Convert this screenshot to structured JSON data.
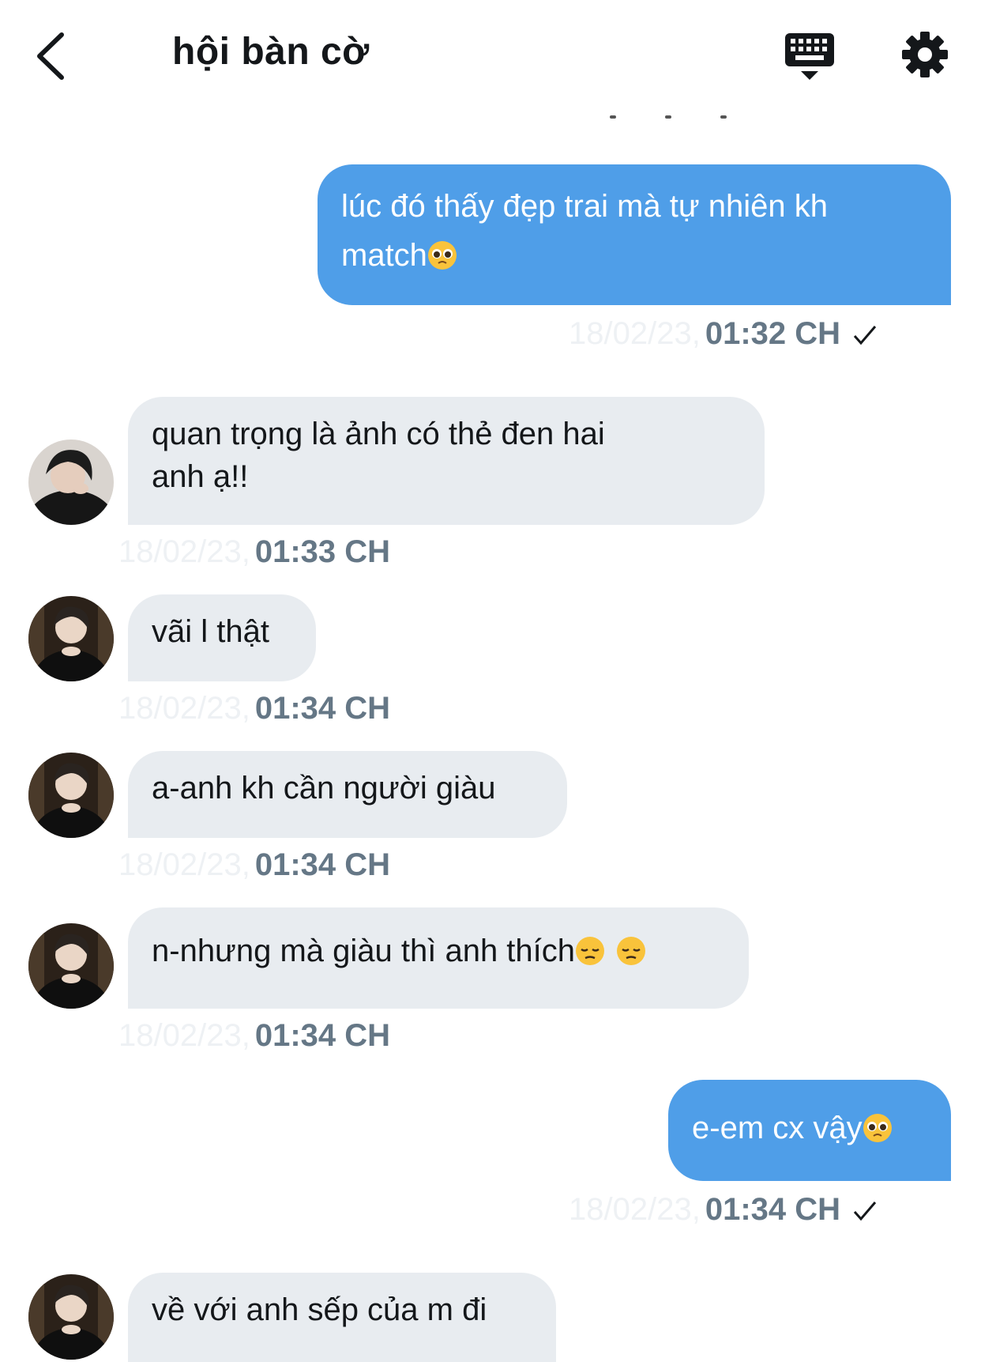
{
  "header": {
    "title": "hội bàn cờ"
  },
  "colors": {
    "outgoing_bubble": "#4f9ee8",
    "incoming_bubble": "#e8ecf0",
    "timestamp": "#657786"
  },
  "icons": [
    "chevron-left-icon",
    "keyboard-icon",
    "gear-icon",
    "check-icon",
    "pleading-face-emoji",
    "pensive-face-emoji"
  ],
  "messages": [
    {
      "dir": "out",
      "text_l1": "lúc đó thấy đẹp trai mà tự nhiên kh",
      "text_l2": "match",
      "emoji": "🥺",
      "date": "18/02/23,",
      "time": "01:32 CH",
      "sent": true
    },
    {
      "dir": "in",
      "text_l1": "quan trọng là ảnh có thẻ đen hai",
      "text_l2": "anh ạ!!",
      "date": "18/02/23,",
      "time": "01:33 CH"
    },
    {
      "dir": "in",
      "text": "vãi l thật",
      "date": "18/02/23,",
      "time": "01:34 CH"
    },
    {
      "dir": "in",
      "text": "a-anh kh cần người giàu",
      "date": "18/02/23,",
      "time": "01:34 CH"
    },
    {
      "dir": "in",
      "text": "n-nhưng mà giàu thì anh thích",
      "emoji": "😔 😔",
      "date": "18/02/23,",
      "time": "01:34 CH"
    },
    {
      "dir": "out",
      "text": "e-em cx vậy",
      "emoji": "🥺",
      "date": "18/02/23,",
      "time": "01:34 CH",
      "sent": true
    },
    {
      "dir": "in",
      "text": "về với anh sếp của m đi"
    }
  ]
}
